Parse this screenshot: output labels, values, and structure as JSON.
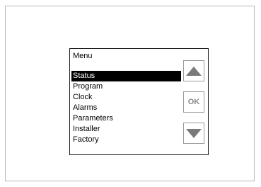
{
  "menu": {
    "title": "Menu",
    "items": [
      {
        "label": "Status",
        "selected": true
      },
      {
        "label": "Program",
        "selected": false
      },
      {
        "label": "Clock",
        "selected": false
      },
      {
        "label": "Alarms",
        "selected": false
      },
      {
        "label": "Parameters",
        "selected": false
      },
      {
        "label": "Installer",
        "selected": false
      },
      {
        "label": "Factory",
        "selected": false
      }
    ]
  },
  "buttons": {
    "up_icon": "triangle-up-icon",
    "ok_label": "OK",
    "down_icon": "triangle-down-icon"
  },
  "colors": {
    "selection_bg": "#000000",
    "selection_fg": "#ffffff",
    "button_icon": "#7a7a7a"
  }
}
